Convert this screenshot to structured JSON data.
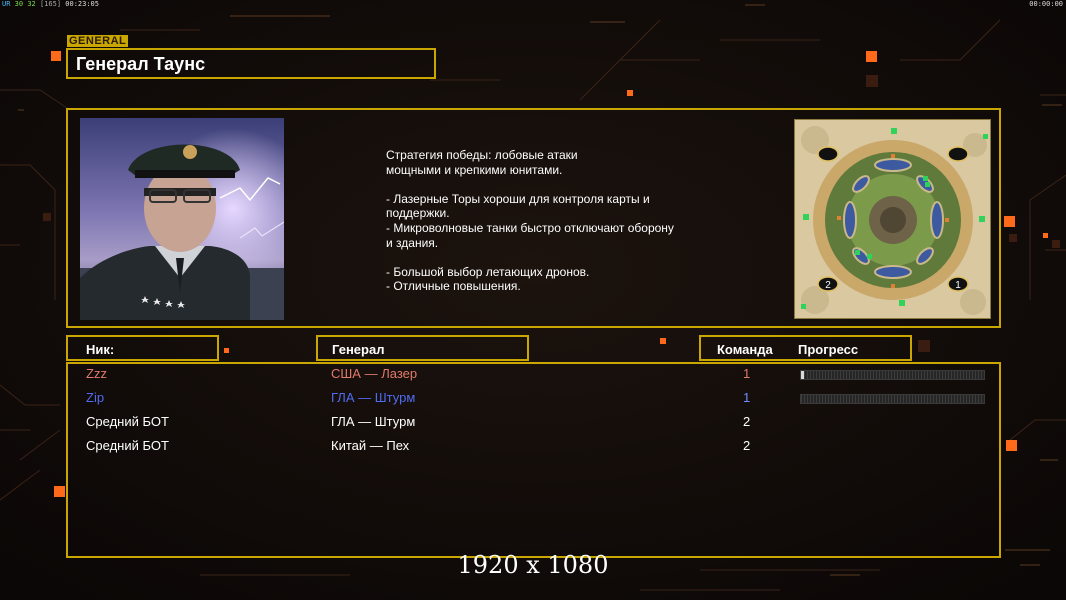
{
  "topbar": {
    "a": "UR",
    "b": "30",
    "c": "32",
    "d": "[165]",
    "time": "00:23:05",
    "right_time": "00:00:00"
  },
  "section_tag": "GENERAL",
  "general": {
    "name": "Генерал Таунс",
    "description": "Стратегия победы: лобовые атаки\nмощными и крепкими юнитами.\n\n- Лазерные Торы хороши для контроля карты и\n поддержки.\n- Микроволновые танки быстро отключают оборону\n и здания.\n\n- Большой выбор летающих дронов.\n- Отличные повышения."
  },
  "minimap": {
    "spawn_labels": [
      "2",
      "1"
    ]
  },
  "table": {
    "headers": {
      "nick": "Ник:",
      "general": "Генерал",
      "team": "Команда",
      "progress": "Прогресс"
    },
    "rows": [
      {
        "nick": "Zzz",
        "general": "США — Лазер",
        "team": "1",
        "color": "#e07a6a",
        "team_color": "#e07a6a",
        "progress": 0.01
      },
      {
        "nick": "Zip",
        "general": "ГЛА — Штурм",
        "team": "1",
        "color": "#4f6cf0",
        "team_color": "#6f8cff",
        "progress": 0.0
      },
      {
        "nick": "Средний БОТ",
        "general": "ГЛА — Штурм",
        "team": "2",
        "color": "#ffffff",
        "team_color": "#ffffff"
      },
      {
        "nick": "Средний БОТ",
        "general": "Китай — Пех",
        "team": "2",
        "color": "#ffffff",
        "team_color": "#ffffff"
      }
    ]
  },
  "watermark": "1920 x 1080",
  "colors": {
    "frame": "#c9a600",
    "accent": "#ff6a1a"
  }
}
